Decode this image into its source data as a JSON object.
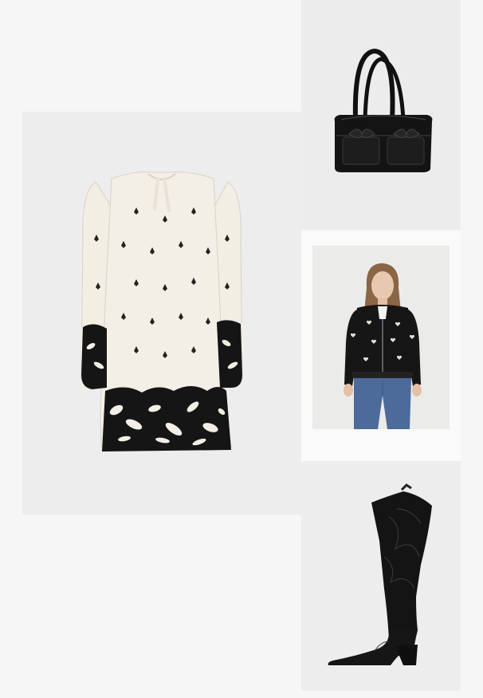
{
  "collage": {
    "items": [
      {
        "name": "dress",
        "icon": "floral-print-dress-image"
      },
      {
        "name": "bag",
        "icon": "black-leather-handbag-image"
      },
      {
        "name": "jacket",
        "icon": "heart-print-bomber-jacket-image"
      },
      {
        "name": "boot",
        "icon": "black-western-knee-boot-image"
      }
    ]
  },
  "colors": {
    "page_bg": "#f6f6f6",
    "tile_bg": "#ededed",
    "cream": "#f4efe6",
    "black": "#141414",
    "denim": "#4c6a9a"
  }
}
